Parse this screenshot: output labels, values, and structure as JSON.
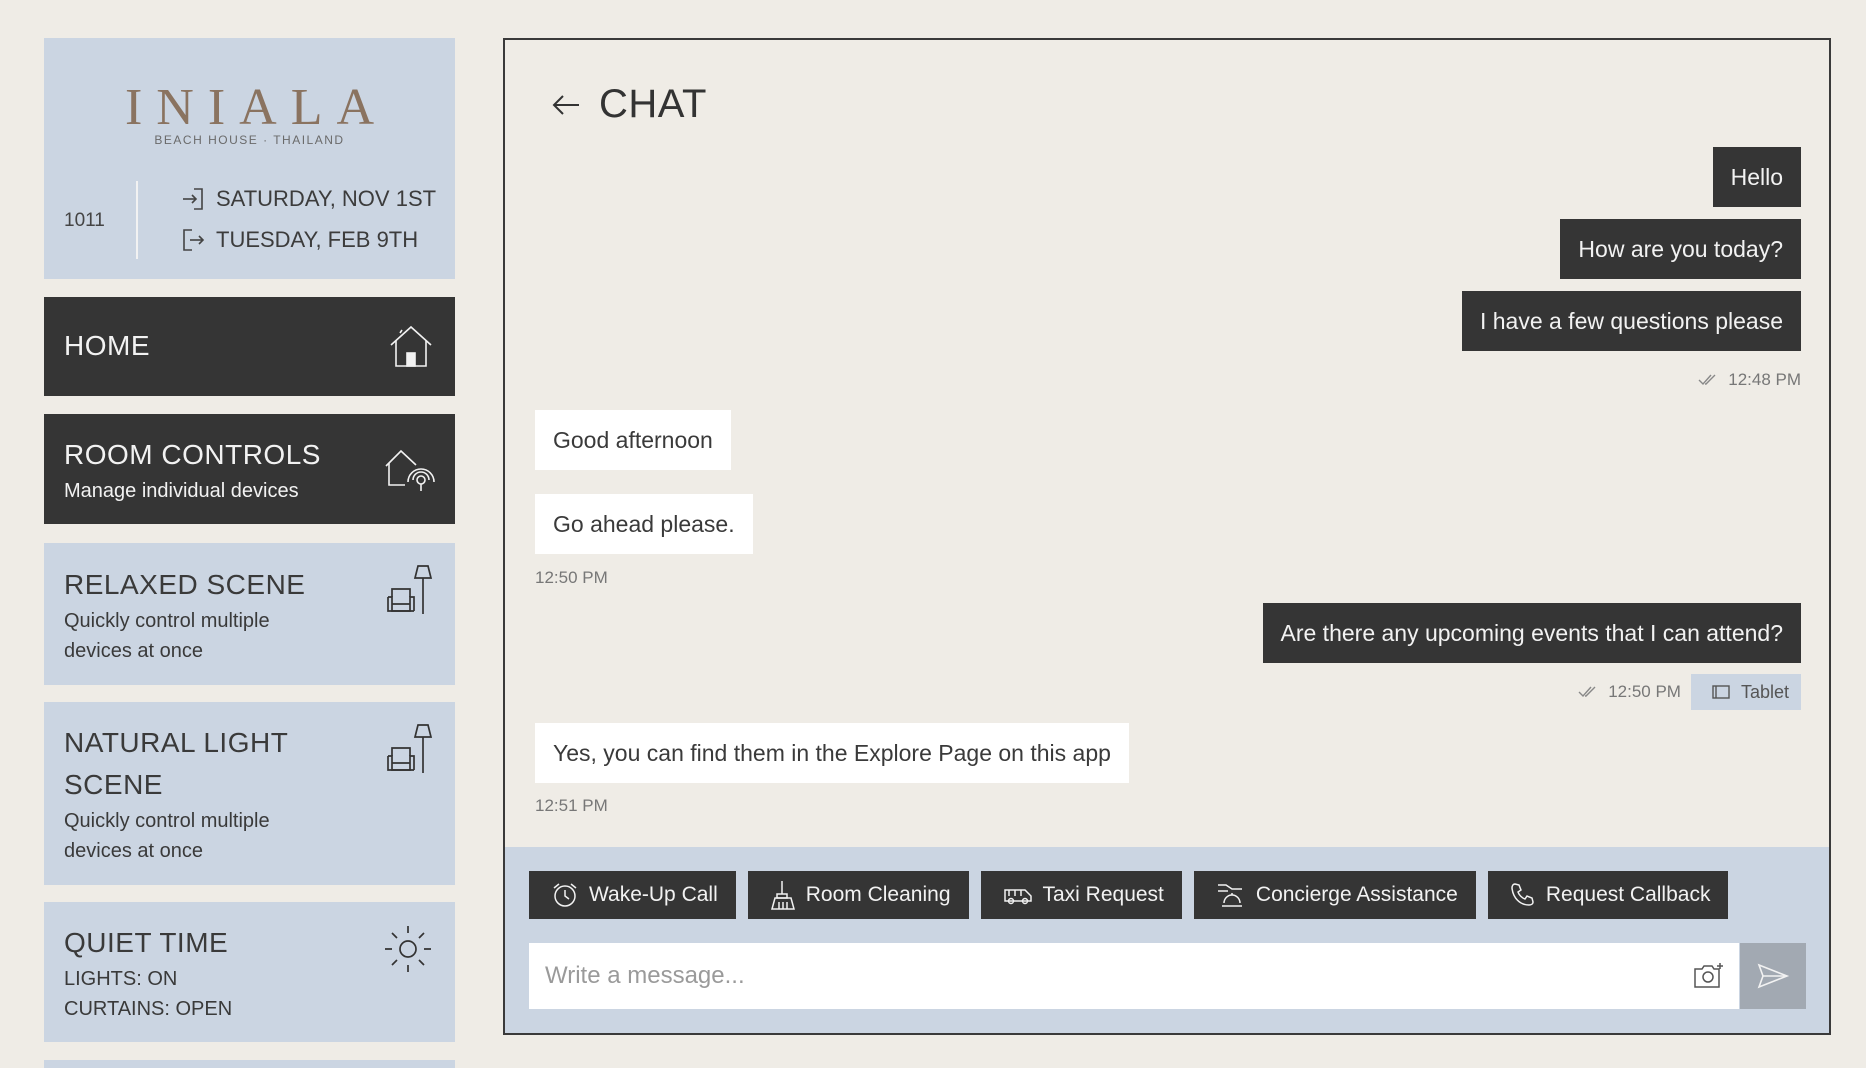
{
  "brand": {
    "logo_text": "INIALA",
    "subtitle": "BEACH HOUSE · THAILAND",
    "room_number": "1011",
    "check_in": "SATURDAY, NOV 1ST",
    "check_out": "TUESDAY, FEB 9TH"
  },
  "menu": [
    {
      "title": "HOME",
      "subtitle": "",
      "icon": "home-icon"
    },
    {
      "title": "ROOM CONTROLS",
      "subtitle": "Manage individual devices",
      "icon": "home-remote-icon"
    },
    {
      "title": "RELAXED SCENE",
      "subtitle_line1": "Quickly control multiple",
      "subtitle_line2": "devices at once",
      "icon": "armchair-lamp-icon"
    },
    {
      "title_line1": "NATURAL LIGHT",
      "title_line2": "SCENE",
      "subtitle_line1": "Quickly control multiple",
      "subtitle_line2": "devices at once",
      "icon": "armchair-lamp-icon"
    },
    {
      "title": "QUIET TIME",
      "subtitle_line1": "LIGHTS: ON",
      "subtitle_line2": "CURTAINS: OPEN",
      "icon": "sun-icon"
    }
  ],
  "chat": {
    "title": "CHAT",
    "messages": [
      {
        "text": "Hello",
        "direction": "out"
      },
      {
        "text": "How are you today?",
        "direction": "out"
      },
      {
        "text": "I have a few questions please",
        "direction": "out"
      },
      {
        "text": "Good afternoon",
        "direction": "in"
      },
      {
        "text": "Go ahead please.",
        "direction": "in"
      },
      {
        "text": "Are there any upcoming events that I can attend?",
        "direction": "out"
      },
      {
        "text": "Yes, you can find them in the Explore Page on this app",
        "direction": "in"
      }
    ],
    "timestamps": {
      "t1": "12:48 PM",
      "t2": "12:50 PM",
      "t3": "12:50 PM",
      "t4": "12:51 PM"
    },
    "device_label": "Tablet",
    "quick_actions": [
      {
        "label": "Wake-Up Call",
        "icon": "alarm-clock-icon"
      },
      {
        "label": "Room Cleaning",
        "icon": "broom-icon"
      },
      {
        "label": "Taxi Request",
        "icon": "taxi-icon"
      },
      {
        "label": "Concierge Assistance",
        "icon": "concierge-bell-icon"
      },
      {
        "label": "Request Callback",
        "icon": "phone-icon"
      }
    ],
    "input_placeholder": "Write a message..."
  },
  "colors": {
    "background": "#efece6",
    "card_light": "#cbd5e2",
    "card_dark": "#353535",
    "logo_brown": "#8a7360",
    "send_button": "#a2a9b2"
  }
}
